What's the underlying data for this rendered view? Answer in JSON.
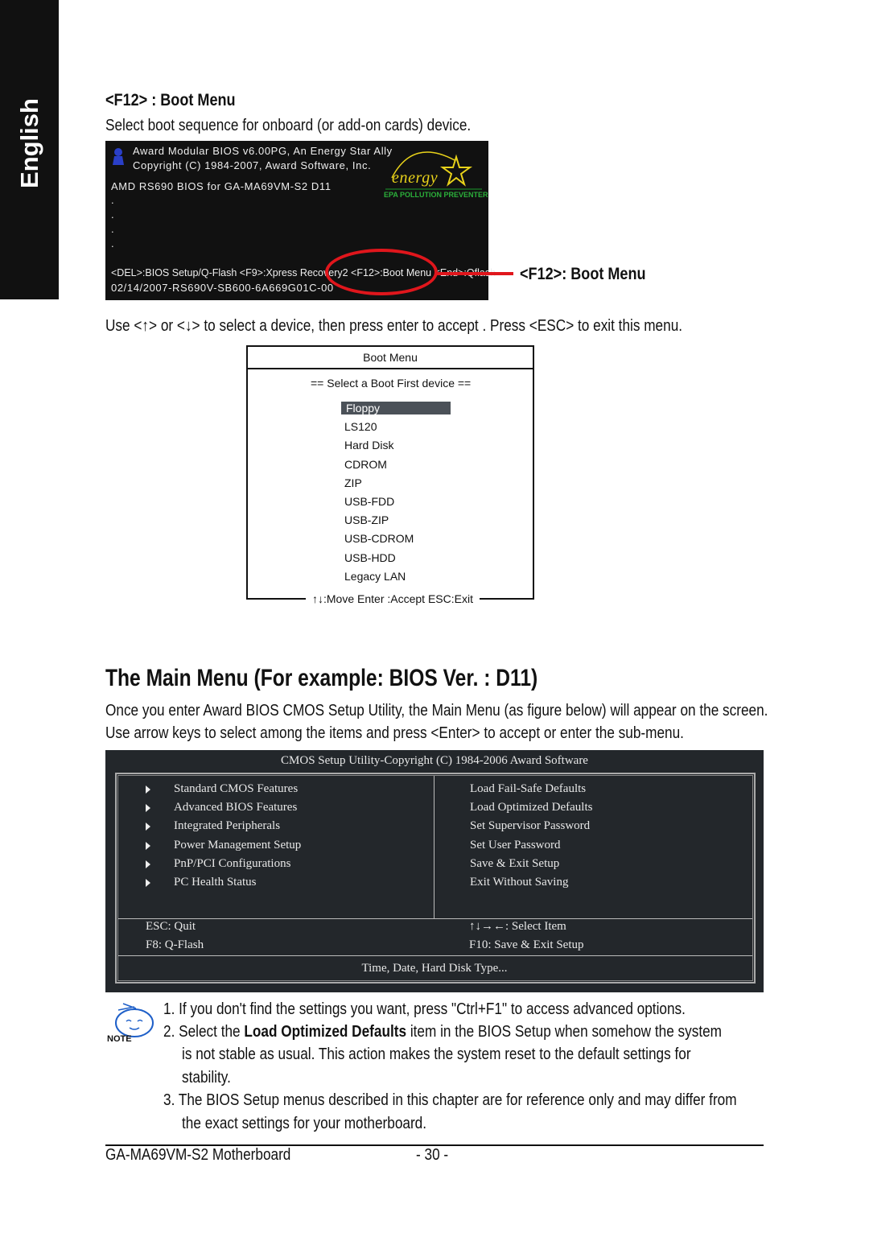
{
  "side_tab": "English",
  "section1": {
    "heading": "<F12> : Boot Menu",
    "intro": "Select boot sequence for onboard (or add-on cards) device.",
    "bios_screen": {
      "line1": "Award Modular BIOS v6.00PG, An Energy Star Ally",
      "line2": "Copyright  (C) 1984-2007, Award Software,  Inc.",
      "line3": "AMD RS690 BIOS for GA-MA69VM-S2 D11",
      "dots": [
        ".",
        ".",
        ".",
        "."
      ],
      "hotkeys": "<DEL>:BIOS Setup/Q-Flash <F9>:Xpress Recovery2 <F12>:Boot Menu <End>:Qflash",
      "bios_id": "02/14/2007-RS690V-SB600-6A669G01C-00",
      "logo_text": "energy",
      "logo_sub": "EPA  POLLUTION PREVENTER"
    },
    "callout": "<F12>: Boot Menu",
    "instructions": "Use <↑> or <↓> to select a device, then press enter to accept . Press <ESC> to exit this menu.",
    "boot_menu": {
      "title": "Boot Menu",
      "subtitle": "==  Select a Boot First device  ==",
      "items": [
        "Floppy",
        "LS120",
        "Hard Disk",
        "CDROM",
        "ZIP",
        "USB-FDD",
        "USB-ZIP",
        "USB-CDROM",
        "USB-HDD",
        "Legacy LAN"
      ],
      "selected": "Floppy",
      "footer": "↑↓:Move    Enter :Accept    ESC:Exit"
    }
  },
  "section2": {
    "heading": "The Main Menu (For example: BIOS Ver. : D11)",
    "para1": "Once you enter Award BIOS CMOS Setup Utility, the Main Menu (as figure below) will appear on the screen.",
    "para2": "Use arrow keys to select among the items and press <Enter> to accept or enter the sub-menu.",
    "cmos": {
      "title": "CMOS Setup Utility-Copyright (C) 1984-2006 Award Software",
      "left_items": [
        "Standard CMOS Features",
        "Advanced BIOS Features",
        "Integrated Peripherals",
        "Power Management Setup",
        "PnP/PCI Configurations",
        "PC Health Status"
      ],
      "right_items": [
        "Load Fail-Safe Defaults",
        "Load Optimized Defaults",
        "Set Supervisor Password",
        "Set User Password",
        "Save & Exit Setup",
        "Exit Without Saving"
      ],
      "keys_left": [
        "ESC: Quit",
        "F8:  Q-Flash"
      ],
      "keys_right": [
        "↑↓→←: Select Item",
        "F10: Save & Exit Setup"
      ],
      "help": "Time, Date, Hard Disk Type..."
    }
  },
  "note": {
    "label": "NOTE",
    "n1": "1. If you don't find the settings you want, press \"Ctrl+F1\" to access advanced options.",
    "n2_pre": "2. Select the ",
    "n2_bold": "Load Optimized Defaults",
    "n2_post": " item in the BIOS Setup when somehow the system",
    "n2_l2": "is not stable as usual. This action makes the system reset to the default settings for",
    "n2_l3": "stability.",
    "n3": "3. The BIOS Setup menus described in this chapter are for reference only and may differ from",
    "n3_l2": "the exact settings for your motherboard."
  },
  "footer": {
    "left": "GA-MA69VM-S2 Motherboard",
    "page": "- 30 -"
  },
  "colors": {
    "callout_red": "#e0161c",
    "cmos_bg": "#23272b",
    "selected_bg": "#4b5158"
  }
}
